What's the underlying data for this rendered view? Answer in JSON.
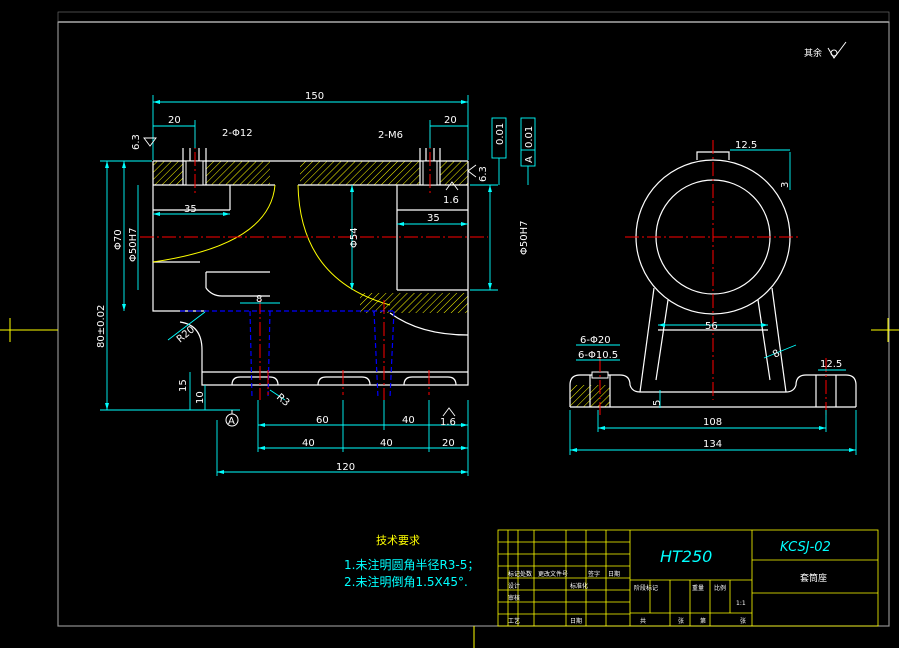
{
  "drawing": {
    "title_block": {
      "material": "HT250",
      "drawing_number": "KCSJ-02",
      "part_name": "套筒座"
    },
    "tech_requirements": {
      "heading": "技术要求",
      "items": [
        "1.未注明圆角半径R3-5；",
        "2.未注明倒角1.5X45°."
      ]
    },
    "roughness_note": "其余",
    "datum_label": "A",
    "front_view_dims": {
      "overall_length": "150",
      "left_top": "20",
      "right_top": "20",
      "holes_left": "2-Φ12",
      "holes_right": "2-M6",
      "bore_left": "35",
      "bore_right": "35",
      "dia_outer": "Φ70",
      "dia_bore_left": "Φ50H7",
      "dia_mid": "Φ54",
      "dia_bore_right": "Φ50H7",
      "height": "80±0.02",
      "rib_width": "8",
      "fillet": "R20",
      "base_thk": "15",
      "base_step": "10",
      "r3": "R3",
      "d60": "60",
      "d40a": "40",
      "d40b": "40",
      "d40c": "40",
      "d20": "20",
      "d120": "120",
      "tol_1": "0.01",
      "tol_2": "0.01",
      "tol_2_ref": "A",
      "ra_left": "6.3",
      "ra_right": "6.3",
      "ra_16a": "1.6",
      "ra_16b": "1.6"
    },
    "side_view_dims": {
      "ra_top": "12.5",
      "top_3": "3",
      "w56": "56",
      "holes_20": "6-Φ20",
      "holes_105": "6-Φ10.5",
      "rib_8": "8",
      "ra_right": "12.5",
      "h5": "5",
      "w108": "108",
      "w134": "134"
    },
    "title_cells": {
      "r1": [
        "标记",
        "处数",
        "更改文件号",
        "签字",
        "日期"
      ],
      "r2": [
        "设计",
        "",
        "标准化"
      ],
      "r3": [
        "审核"
      ],
      "r4": [
        "工艺",
        "",
        "日期"
      ],
      "stage": [
        "阶段标记",
        "重量",
        "比例"
      ],
      "scale": "1:1",
      "sheet": [
        "共",
        "张",
        "第",
        "张"
      ]
    },
    "colors": {
      "frame": "#ffffff",
      "outline": "#ffffff",
      "center": "#ff0000",
      "dimension": "#00ffff",
      "hatch": "#ffff00",
      "hidden": "#0000ff",
      "boundary": "#ffff00",
      "crosshair": "#ffff00"
    }
  }
}
